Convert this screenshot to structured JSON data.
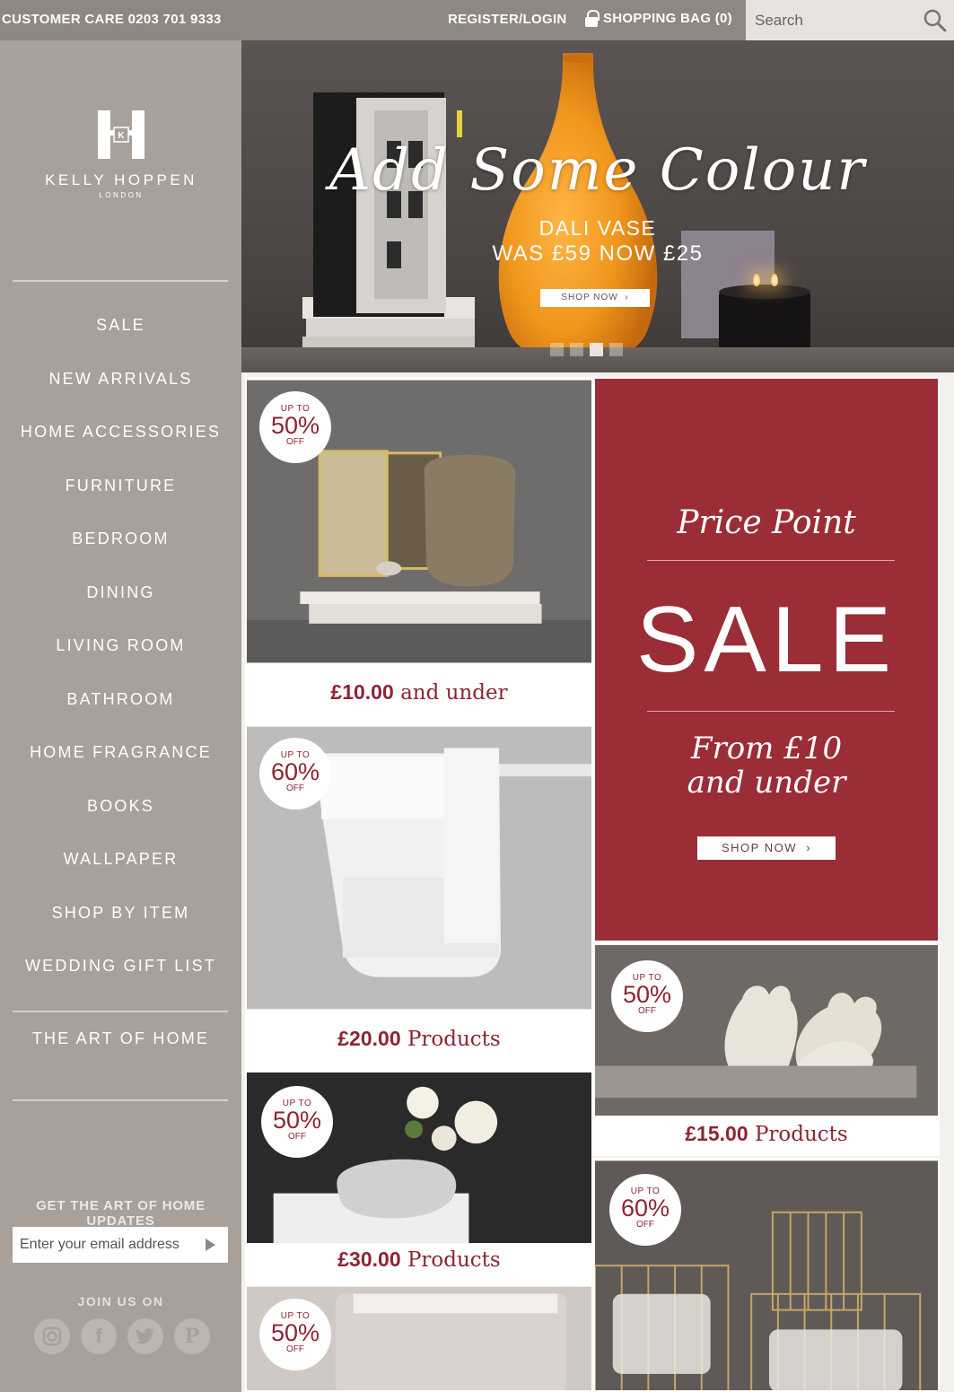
{
  "topbar": {
    "customer_care": "CUSTOMER CARE 0203 701 9333",
    "register": "REGISTER/LOGIN",
    "bag": "SHOPPING BAG (0)",
    "search_placeholder": "Search"
  },
  "logo": {
    "brand": "KELLY HOPPEN",
    "city": "LONDON"
  },
  "nav": [
    "SALE",
    "NEW ARRIVALS",
    "HOME ACCESSORIES",
    "FURNITURE",
    "BEDROOM",
    "DINING",
    "LIVING ROOM",
    "BATHROOM",
    "HOME FRAGRANCE",
    "BOOKS",
    "WALLPAPER",
    "SHOP BY ITEM",
    "WEDDING GIFT LIST"
  ],
  "art_of_home": "THE ART OF HOME",
  "newsletter": {
    "heading": "GET THE ART OF HOME UPDATES",
    "placeholder": "Enter your email address"
  },
  "join_us": "JOIN US ON",
  "socials": [
    "instagram-icon",
    "facebook-icon",
    "twitter-icon",
    "pinterest-icon"
  ],
  "hero": {
    "title": "Add Some Colour",
    "product": "DALI VASE",
    "price": "WAS £59 NOW £25",
    "cta": "SHOP NOW",
    "slides": 4,
    "active_slide": 3
  },
  "price_point": {
    "title": "Price Point",
    "sale": "SALE",
    "from": "From £10",
    "and_under": "and under",
    "cta": "SHOP NOW"
  },
  "tiles": [
    {
      "badge_top": "UP TO",
      "badge_pct": "50%",
      "badge_off": "OFF",
      "price": "£10.00",
      "label": "and under"
    },
    {
      "badge_top": "UP TO",
      "badge_pct": "60%",
      "badge_off": "OFF",
      "price": "£20.00",
      "label": "Products"
    },
    {
      "badge_top": "UP TO",
      "badge_pct": "50%",
      "badge_off": "OFF",
      "price": "£30.00",
      "label": "Products"
    },
    {
      "badge_top": "UP TO",
      "badge_pct": "50%",
      "badge_off": "OFF",
      "price": "£15.00",
      "label": "Products"
    },
    {
      "badge_top": "UP TO",
      "badge_pct": "60%",
      "badge_off": "OFF"
    },
    {
      "badge_top": "UP TO",
      "badge_pct": "50%",
      "badge_off": "OFF"
    }
  ],
  "colors": {
    "accent": "#8e2434",
    "sidebar": "#a9a09a",
    "topbar": "#8f8781",
    "sale_red": "#9b2d37"
  }
}
